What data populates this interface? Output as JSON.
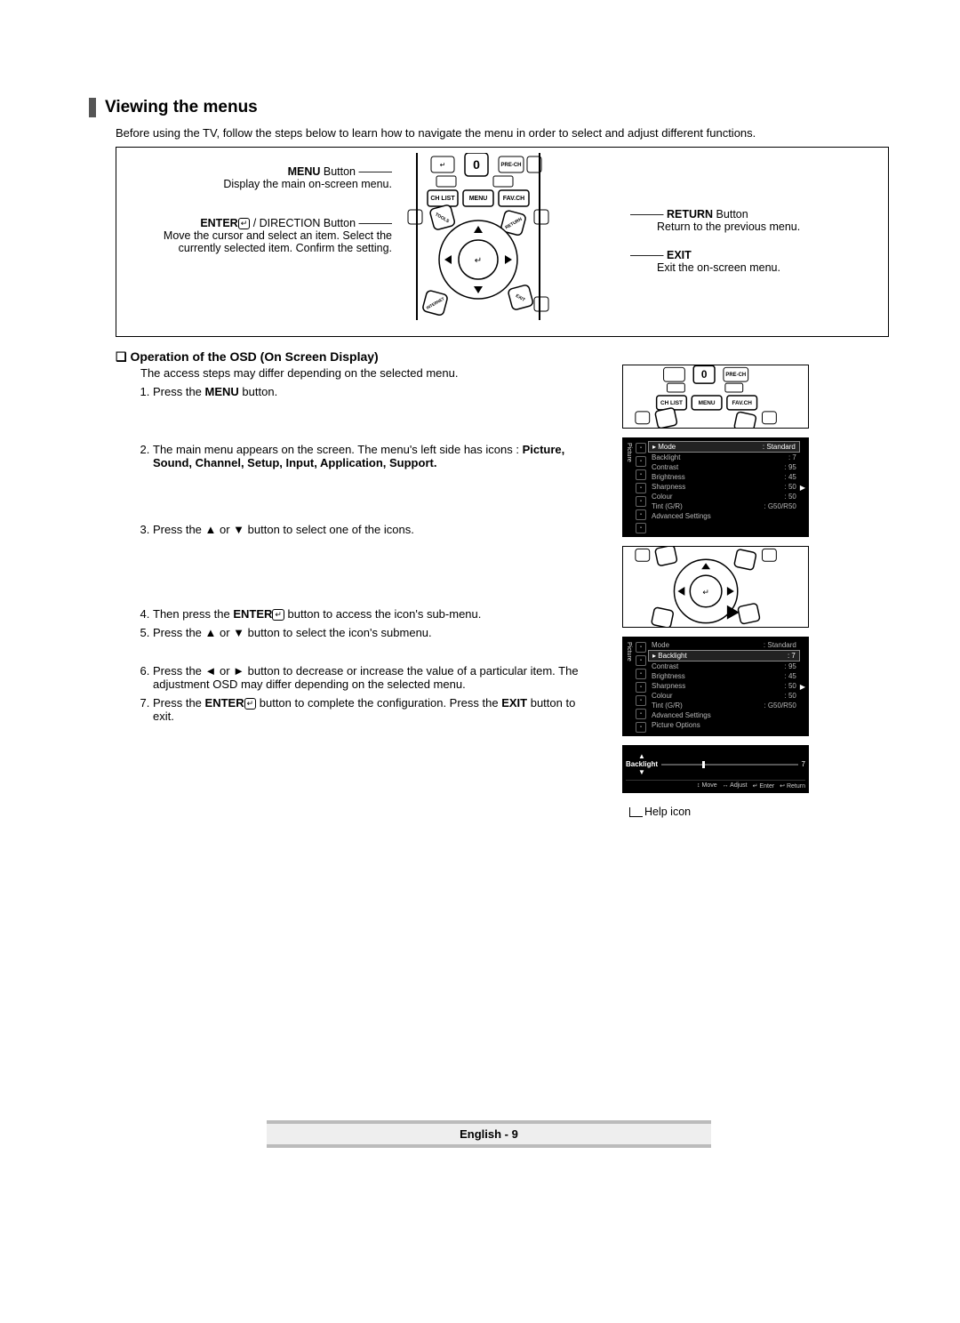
{
  "header": {
    "title": "Viewing the menus"
  },
  "intro": "Before using the TV, follow the steps below to learn how to navigate the menu in order to select and adjust different functions.",
  "remote": {
    "menu_btn_title": "MENU",
    "menu_btn_suffix": " Button",
    "menu_btn_desc": "Display the main on-screen menu.",
    "enter_title": "ENTER",
    "enter_suffix": " / DIRECTION Button",
    "enter_desc": "Move the cursor and select an item. Select the currently selected item. Confirm the setting.",
    "return_title": "RETURN",
    "return_suffix": " Button",
    "return_desc": "Return to the previous menu.",
    "exit_title": "EXIT",
    "exit_desc": "Exit the on-screen menu.",
    "labels": {
      "chlist": "CH LIST",
      "menu": "MENU",
      "favch": "FAV.CH",
      "prech": "PRE-CH",
      "zero": "0",
      "tools": "TOOLS",
      "return": "RETURN",
      "internet": "INTERNET",
      "exit": "EXIT"
    }
  },
  "sub_heading": "Operation of the OSD (On Screen Display)",
  "steps": {
    "intro": "The access steps may differ depending on the selected menu.",
    "s1_a": "Press the ",
    "s1_b": "MENU",
    "s1_c": " button.",
    "s2_a": "The main menu appears on the screen. The menu's left side has icons : ",
    "s2_b": "Picture, Sound, Channel, Setup, Input, Application, Support.",
    "s3": "Press the ▲ or ▼ button to select one of the icons.",
    "s4_a": "Then press the ",
    "s4_b": "ENTER",
    "s4_c": " button to access the icon's sub-menu.",
    "s5": "Press the ▲ or ▼ button to select the icon's submenu.",
    "s6": "Press the ◄ or ► button to decrease or increase the value of a particular item. The adjustment OSD may differ depending on the selected menu.",
    "s7_a": "Press the ",
    "s7_b": "ENTER",
    "s7_c": " button to complete the configuration. Press the ",
    "s7_d": "EXIT",
    "s7_e": " button to exit."
  },
  "osd": {
    "side_label": "Picture",
    "rows": [
      {
        "k": "Mode",
        "v": ": Standard"
      },
      {
        "k": "Backlight",
        "v": ": 7"
      },
      {
        "k": "Contrast",
        "v": ": 95"
      },
      {
        "k": "Brightness",
        "v": ": 45"
      },
      {
        "k": "Sharpness",
        "v": ": 50"
      },
      {
        "k": "Colour",
        "v": ": 50"
      },
      {
        "k": "Tint (G/R)",
        "v": ": G50/R50"
      },
      {
        "k": "Advanced Settings",
        "v": ""
      }
    ],
    "rows2": [
      {
        "k": "Mode",
        "v": ": Standard"
      },
      {
        "k": "Backlight",
        "v": ": 7"
      },
      {
        "k": "Contrast",
        "v": ": 95"
      },
      {
        "k": "Brightness",
        "v": ": 45"
      },
      {
        "k": "Sharpness",
        "v": ": 50"
      },
      {
        "k": "Colour",
        "v": ": 50"
      },
      {
        "k": "Tint (G/R)",
        "v": ": G50/R50"
      },
      {
        "k": "Advanced Settings",
        "v": ""
      },
      {
        "k": "Picture Options",
        "v": ""
      }
    ],
    "adjust": {
      "label": "Backlight",
      "value": "7",
      "footer": [
        "Move",
        "Adjust",
        "Enter",
        "Return"
      ],
      "footer_icons": [
        "↕",
        "↔",
        "↵",
        "↩"
      ]
    }
  },
  "help_caption": "Help icon",
  "footer": "English - 9"
}
